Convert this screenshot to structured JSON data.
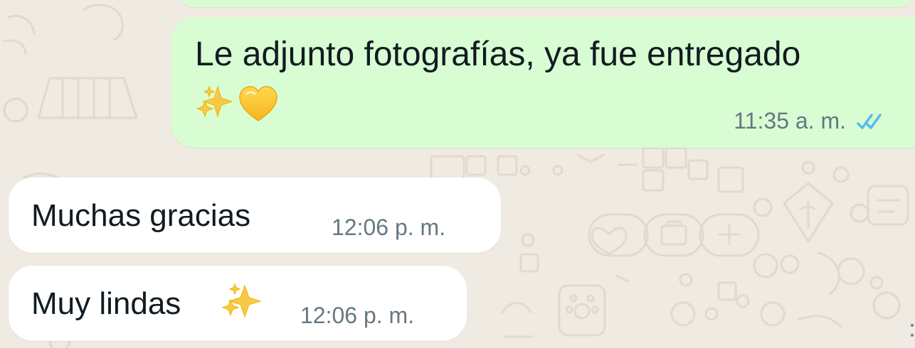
{
  "chat": {
    "messages": [
      {
        "direction": "outgoing",
        "text": "Le adjunto fotografías, ya fue entregado",
        "emoji": [
          "sparkles-icon",
          "yellow-heart-icon"
        ],
        "time": "11:35 a. m.",
        "status": "read"
      },
      {
        "direction": "incoming",
        "text": "Muchas gracias",
        "time": "12:06 p. m."
      },
      {
        "direction": "incoming",
        "text": "Muy lindas",
        "emoji": [
          "sparkles-icon"
        ],
        "time": "12:06 p. m."
      }
    ]
  },
  "colors": {
    "background": "#efeae2",
    "outgoing_bubble": "#d9fdd3",
    "incoming_bubble": "#ffffff",
    "timestamp": "#667781",
    "read_ticks": "#53bdeb"
  }
}
